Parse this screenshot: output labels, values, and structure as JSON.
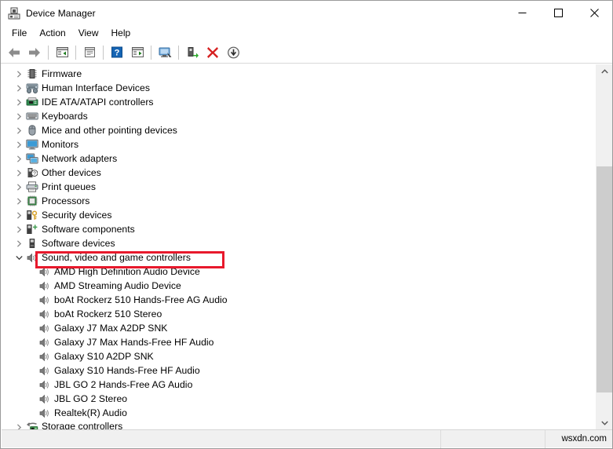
{
  "window": {
    "title": "Device Manager",
    "icon": "device-manager-icon",
    "controls": {
      "minimize": "—",
      "maximize": "□",
      "close": "✕"
    }
  },
  "menubar": {
    "items": [
      {
        "label": "File"
      },
      {
        "label": "Action"
      },
      {
        "label": "View"
      },
      {
        "label": "Help"
      }
    ]
  },
  "toolbar": {
    "buttons": [
      {
        "name": "back-button",
        "icon": "left-arrow-icon"
      },
      {
        "name": "forward-button",
        "icon": "right-arrow-icon"
      },
      {
        "name": "separator-1",
        "icon": "separator"
      },
      {
        "name": "show-hide-console-tree-button",
        "icon": "console-tree-icon"
      },
      {
        "name": "separator-2",
        "icon": "separator"
      },
      {
        "name": "properties-button",
        "icon": "properties-icon"
      },
      {
        "name": "separator-3",
        "icon": "separator"
      },
      {
        "name": "help-button",
        "icon": "help-question-icon"
      },
      {
        "name": "show-hide-action-pane-button",
        "icon": "action-pane-icon"
      },
      {
        "name": "separator-4",
        "icon": "separator"
      },
      {
        "name": "scan-for-hardware-changes-button",
        "icon": "scan-monitor-icon"
      },
      {
        "name": "separator-5",
        "icon": "separator"
      },
      {
        "name": "update-driver-button",
        "icon": "update-driver-icon"
      },
      {
        "name": "uninstall-device-button",
        "icon": "red-x-icon"
      },
      {
        "name": "disable-device-button",
        "icon": "disable-down-arrow-icon"
      }
    ]
  },
  "tree": {
    "nodes": [
      {
        "label": "Firmware",
        "level": 1,
        "expanded": false,
        "icon": "firmware-icon",
        "highlighted": false,
        "clipped": false
      },
      {
        "label": "Human Interface Devices",
        "level": 1,
        "expanded": false,
        "icon": "hid-icon",
        "highlighted": false,
        "clipped": false
      },
      {
        "label": "IDE ATA/ATAPI controllers",
        "level": 1,
        "expanded": false,
        "icon": "ide-controller-icon",
        "highlighted": false,
        "clipped": false
      },
      {
        "label": "Keyboards",
        "level": 1,
        "expanded": false,
        "icon": "keyboard-icon",
        "highlighted": false,
        "clipped": false
      },
      {
        "label": "Mice and other pointing devices",
        "level": 1,
        "expanded": false,
        "icon": "mouse-icon",
        "highlighted": false,
        "clipped": false
      },
      {
        "label": "Monitors",
        "level": 1,
        "expanded": false,
        "icon": "monitor-icon",
        "highlighted": false,
        "clipped": false
      },
      {
        "label": "Network adapters",
        "level": 1,
        "expanded": false,
        "icon": "network-adapter-icon",
        "highlighted": false,
        "clipped": false
      },
      {
        "label": "Other devices",
        "level": 1,
        "expanded": false,
        "icon": "other-device-icon",
        "highlighted": false,
        "clipped": false
      },
      {
        "label": "Print queues",
        "level": 1,
        "expanded": false,
        "icon": "printer-icon",
        "highlighted": false,
        "clipped": false
      },
      {
        "label": "Processors",
        "level": 1,
        "expanded": false,
        "icon": "processor-icon",
        "highlighted": false,
        "clipped": false
      },
      {
        "label": "Security devices",
        "level": 1,
        "expanded": false,
        "icon": "security-device-icon",
        "highlighted": false,
        "clipped": false
      },
      {
        "label": "Software components",
        "level": 1,
        "expanded": false,
        "icon": "software-component-icon",
        "highlighted": false,
        "clipped": false
      },
      {
        "label": "Software devices",
        "level": 1,
        "expanded": false,
        "icon": "software-device-icon",
        "highlighted": false,
        "clipped": false
      },
      {
        "label": "Sound, video and game controllers",
        "level": 1,
        "expanded": true,
        "icon": "speaker-icon",
        "highlighted": true,
        "clipped": false
      },
      {
        "label": "AMD High Definition Audio Device",
        "level": 2,
        "expanded": null,
        "icon": "speaker-icon",
        "highlighted": false,
        "clipped": false
      },
      {
        "label": "AMD Streaming Audio Device",
        "level": 2,
        "expanded": null,
        "icon": "speaker-icon",
        "highlighted": false,
        "clipped": false
      },
      {
        "label": "boAt Rockerz 510 Hands-Free AG Audio",
        "level": 2,
        "expanded": null,
        "icon": "speaker-icon",
        "highlighted": false,
        "clipped": false
      },
      {
        "label": "boAt Rockerz 510 Stereo",
        "level": 2,
        "expanded": null,
        "icon": "speaker-icon",
        "highlighted": false,
        "clipped": false
      },
      {
        "label": "Galaxy J7 Max A2DP SNK",
        "level": 2,
        "expanded": null,
        "icon": "speaker-icon",
        "highlighted": false,
        "clipped": false
      },
      {
        "label": "Galaxy J7 Max Hands-Free HF Audio",
        "level": 2,
        "expanded": null,
        "icon": "speaker-icon",
        "highlighted": false,
        "clipped": false
      },
      {
        "label": "Galaxy S10 A2DP SNK",
        "level": 2,
        "expanded": null,
        "icon": "speaker-icon",
        "highlighted": false,
        "clipped": false
      },
      {
        "label": "Galaxy S10 Hands-Free HF Audio",
        "level": 2,
        "expanded": null,
        "icon": "speaker-icon",
        "highlighted": false,
        "clipped": false
      },
      {
        "label": "JBL GO 2 Hands-Free AG Audio",
        "level": 2,
        "expanded": null,
        "icon": "speaker-icon",
        "highlighted": false,
        "clipped": false
      },
      {
        "label": "JBL GO 2 Stereo",
        "level": 2,
        "expanded": null,
        "icon": "speaker-icon",
        "highlighted": false,
        "clipped": false
      },
      {
        "label": "Realtek(R) Audio",
        "level": 2,
        "expanded": null,
        "icon": "speaker-icon",
        "highlighted": false,
        "clipped": false
      },
      {
        "label": "Storage controllers",
        "level": 1,
        "expanded": false,
        "icon": "storage-controller-icon",
        "highlighted": false,
        "clipped": true
      }
    ]
  },
  "scrollbar": {
    "up_arrow": "⌃",
    "down_arrow": "⌄"
  },
  "statusbar": {
    "pane1": "",
    "pane2": "",
    "watermark": "wsxdn.com"
  },
  "colors": {
    "highlight_red": "#e8192c",
    "chevron_gray": "#8a8a8a",
    "titlebar_bg": "#ffffff",
    "status_bg": "#f0f0f0"
  }
}
